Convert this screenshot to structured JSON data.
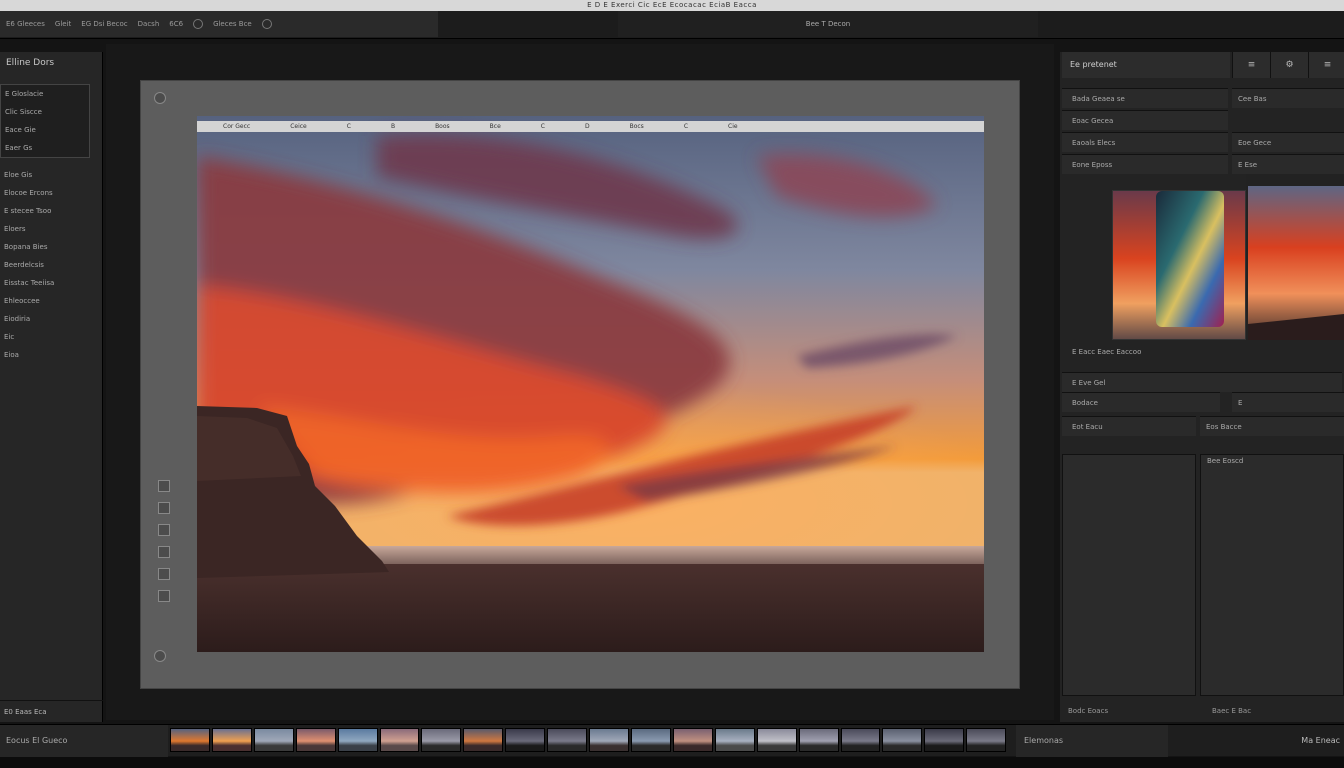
{
  "window": {
    "title": "E D E Exerci Cic EcE Ecocacac EciaB Eacca"
  },
  "topbar": {
    "items": [
      "E6 Gleeces",
      "Gleit",
      "EG Dsi Becoc",
      "Dacsh",
      "6C6",
      "Gleces Bce"
    ],
    "center_label": "Bee T Decon"
  },
  "left_panel": {
    "header": "Elline Dors",
    "rows": [
      "E Gloslacie",
      "Clic Siscce",
      "Eace Gie",
      "Eaer Gs",
      "Eloe Gis",
      "Elocoe Ercons",
      "E stecee Tsoo",
      "Eloers",
      "Bopana Bies",
      "Beerdelcsis",
      "Eisstac Teeiisa",
      "Ehleoccee",
      "Eiodiria",
      "Eic",
      "Eioa"
    ],
    "footer": "E0 Eaas Eca"
  },
  "photo_toolbar": [
    "Cor Gecc",
    "Ceice",
    "C",
    "B",
    "Boos",
    "Bce",
    "C",
    "D",
    "Bocs",
    "C",
    "Cie"
  ],
  "right_panel": {
    "header": "Ee pretenet",
    "tabs": [
      "≡",
      "⚙",
      "≡"
    ],
    "rows": [
      "Bada Geaea se",
      "Eoac Gecea",
      "Eaoals Elecs",
      "Eone Eposs"
    ],
    "rows_right": [
      "Cee Bas",
      "Eoe Gece",
      "E Ese"
    ],
    "preview_caption": "E Eacc Eaec Eaccoo",
    "mid_row": "E Eve Gel",
    "tool_row": [
      "Bodace",
      "E",
      "Bae"
    ],
    "list_left": "Eot  Eacu",
    "list_right": "Eos  Bacce",
    "list_right2": "Bee Eoscd",
    "footer_left": "Bodc Eoacs",
    "footer_right": "Baec E Bac"
  },
  "filmstrip": {
    "left_label": "Eocus El Gueco",
    "right_label": "Elemonas",
    "far_right": "Ma Eneac",
    "thumb_count": 20
  },
  "colors": {
    "sky_top": "#5b6b88",
    "cloud_red": "#c8361e",
    "horizon_orange": "#f28a2a",
    "ground": "#3a2523"
  }
}
